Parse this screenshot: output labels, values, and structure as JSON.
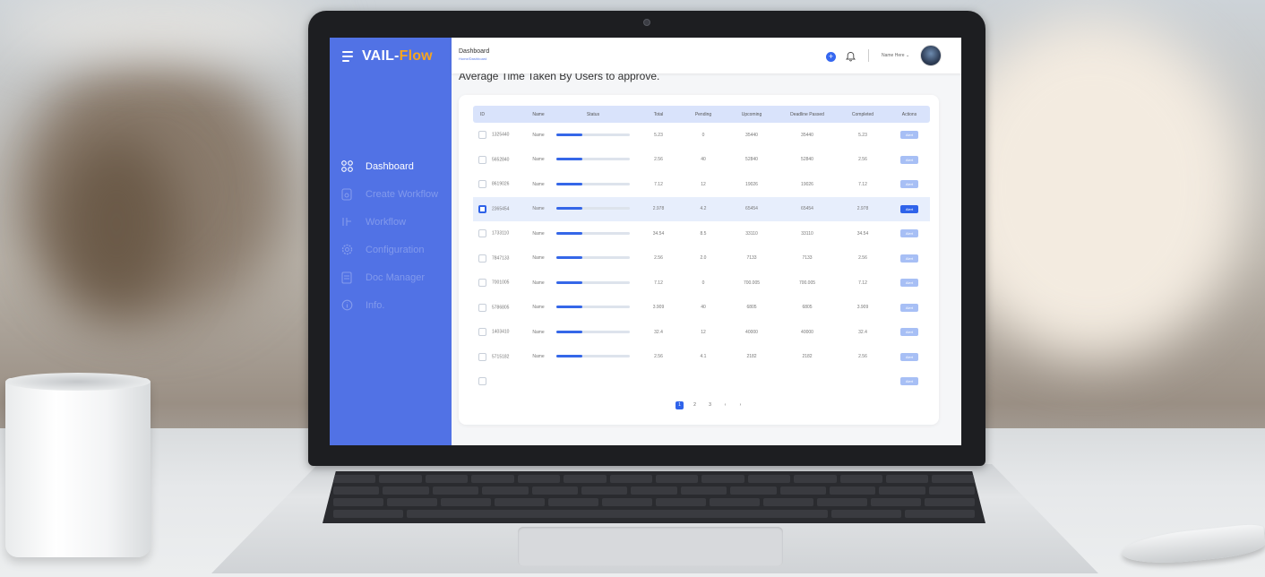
{
  "app": {
    "brand_main": "VAIL-",
    "brand_accent": "Flow",
    "accent_color": "#f7a51f",
    "sidebar_color": "#5172e5"
  },
  "sidebar": {
    "items": [
      {
        "label": "Dashboard",
        "icon": "grid-icon",
        "active": true
      },
      {
        "label": "Create Workflow",
        "icon": "document-icon",
        "active": false
      },
      {
        "label": "Workflow",
        "icon": "workflow-icon",
        "active": false
      },
      {
        "label": "Configuration",
        "icon": "gear-icon",
        "active": false
      },
      {
        "label": "Doc Manager",
        "icon": "folder-icon",
        "active": false
      },
      {
        "label": "Info.",
        "icon": "info-icon",
        "active": false
      }
    ]
  },
  "header": {
    "title": "Dashboard",
    "breadcrumb": "Home/Dashboard",
    "add_label": "+",
    "user_name": "Name Here ⌄"
  },
  "main": {
    "heading": "Average Time Taken By Users to approve."
  },
  "table": {
    "columns": [
      "ID",
      "Name",
      "Status",
      "Total",
      "Pending",
      "Upcoming",
      "Deadline Passed",
      "Completed",
      "Actions"
    ],
    "rows": [
      {
        "id": "1325440",
        "name": "Name",
        "progress": 0.35,
        "total": "5.23",
        "pending": "0",
        "upcoming": "35440",
        "deadline": "35440",
        "completed": "5.23",
        "action": "Alert",
        "selected": false
      },
      {
        "id": "5652840",
        "name": "Name",
        "progress": 0.35,
        "total": "2.56",
        "pending": "40",
        "upcoming": "52840",
        "deadline": "52840",
        "completed": "2.56",
        "action": "Alert",
        "selected": false
      },
      {
        "id": "8619026",
        "name": "Name",
        "progress": 0.35,
        "total": "7.12",
        "pending": "12",
        "upcoming": "19026",
        "deadline": "19026",
        "completed": "7.12",
        "action": "Alert",
        "selected": false
      },
      {
        "id": "2365454",
        "name": "Name",
        "progress": 0.35,
        "total": "2.978",
        "pending": "4.2",
        "upcoming": "65454",
        "deadline": "65454",
        "completed": "2.978",
        "action": "Alert",
        "selected": true
      },
      {
        "id": "1733110",
        "name": "Name",
        "progress": 0.35,
        "total": "34.54",
        "pending": "8.5",
        "upcoming": "33110",
        "deadline": "33110",
        "completed": "34.54",
        "action": "Alert",
        "selected": false
      },
      {
        "id": "7847133",
        "name": "Name",
        "progress": 0.35,
        "total": "2.56",
        "pending": "2.0",
        "upcoming": "7133",
        "deadline": "7133",
        "completed": "2.56",
        "action": "Alert",
        "selected": false
      },
      {
        "id": "7001005",
        "name": "Name",
        "progress": 0.35,
        "total": "7.12",
        "pending": "0",
        "upcoming": "700.005",
        "deadline": "700.005",
        "completed": "7.12",
        "action": "Alert",
        "selected": false
      },
      {
        "id": "5786805",
        "name": "Name",
        "progress": 0.35,
        "total": "3.909",
        "pending": "40",
        "upcoming": "6805",
        "deadline": "6805",
        "completed": "3.909",
        "action": "Alert",
        "selected": false
      },
      {
        "id": "1403410",
        "name": "Name",
        "progress": 0.35,
        "total": "32.4",
        "pending": "12",
        "upcoming": "40000",
        "deadline": "40000",
        "completed": "32.4",
        "action": "Alert",
        "selected": false
      },
      {
        "id": "5715182",
        "name": "Name",
        "progress": 0.35,
        "total": "2.56",
        "pending": "4.1",
        "upcoming": "2182",
        "deadline": "2182",
        "completed": "2.56",
        "action": "Alert",
        "selected": false
      },
      {
        "id": "",
        "name": "",
        "progress": null,
        "total": "",
        "pending": "",
        "upcoming": "",
        "deadline": "",
        "completed": "",
        "action": "Alert",
        "selected": false
      }
    ]
  },
  "pagination": {
    "pages": [
      "1",
      "2",
      "3"
    ],
    "current": "1",
    "prev": "‹",
    "next": "›"
  }
}
